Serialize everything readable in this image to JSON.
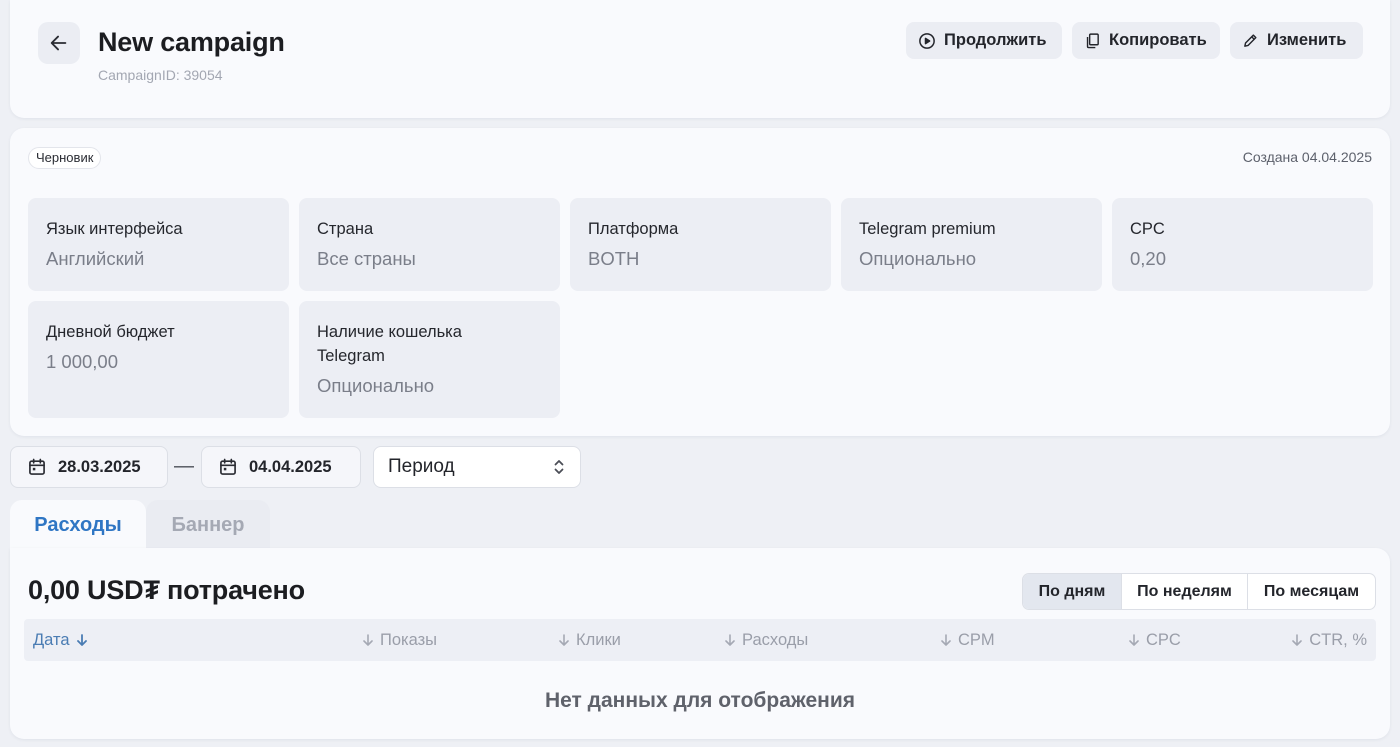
{
  "header": {
    "title": "New campaign",
    "campaign_id": "CampaignID: 39054",
    "buttons": {
      "continue": "Продолжить",
      "copy": "Копировать",
      "edit": "Изменить"
    }
  },
  "info": {
    "status": "Черновик",
    "created": "Создана 04.04.2025",
    "tiles": [
      {
        "label": "Язык интерфейса",
        "value": "Английский"
      },
      {
        "label": "Страна",
        "value": "Все страны"
      },
      {
        "label": "Платформа",
        "value": "BOTH"
      },
      {
        "label": "Telegram premium",
        "value": "Опционально"
      },
      {
        "label": "CPC",
        "value": "0,20"
      },
      {
        "label": "Дневной бюджет",
        "value": "1 000,00"
      },
      {
        "label": "Наличие кошелька Telegram",
        "value": "Опционально"
      }
    ]
  },
  "filters": {
    "date_from": "28.03.2025",
    "date_separator": "—",
    "date_to": "04.04.2025",
    "period_value": "Период"
  },
  "tabs": [
    {
      "label": "Расходы",
      "active": true
    },
    {
      "label": "Баннер",
      "active": false
    }
  ],
  "report": {
    "spent_title": "0,00 USD₮ потрачено",
    "granularity": [
      {
        "label": "По дням",
        "active": true
      },
      {
        "label": "По неделям",
        "active": false
      },
      {
        "label": "По месяцам",
        "active": false
      }
    ],
    "columns": [
      "Дата",
      "Показы",
      "Клики",
      "Расходы",
      "CPM",
      "CPC",
      "CTR, %"
    ],
    "empty_text": "Нет данных для отображения"
  },
  "colors": {
    "accent": "#2f76c4",
    "background": "#eef0f5",
    "card": "#f9fafd",
    "tile": "#eceef4"
  },
  "icons": {
    "back": "arrow-left-icon",
    "continue": "play-circle-icon",
    "copy": "copy-icon",
    "edit": "pencil-icon",
    "calendar": "calendar-icon",
    "select": "chevron-up-down-icon",
    "sort": "arrow-down-icon"
  }
}
